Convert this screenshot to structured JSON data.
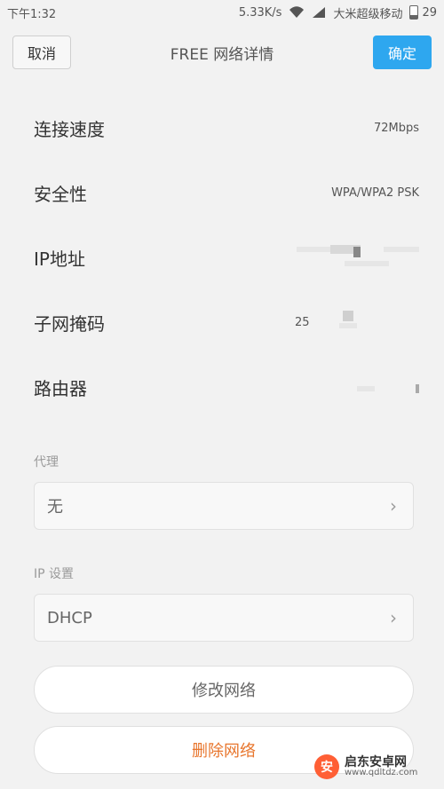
{
  "status_bar": {
    "time": "下午1:32",
    "speed": "5.33K/s",
    "carrier": "大米超级移动",
    "battery": "29",
    "battery_level_percent": 29
  },
  "header": {
    "cancel": "取消",
    "title": "FREE 网络详情",
    "confirm": "确定"
  },
  "info": [
    {
      "label": "连接速度",
      "value": "72Mbps"
    },
    {
      "label": "安全性",
      "value": "WPA/WPA2 PSK"
    },
    {
      "label": "IP地址",
      "value": ""
    },
    {
      "label": "子网掩码",
      "value": "25"
    },
    {
      "label": "路由器",
      "value": ""
    }
  ],
  "proxy": {
    "label": "代理",
    "value": "无"
  },
  "ip_settings": {
    "label": "IP 设置",
    "value": "DHCP"
  },
  "actions": {
    "modify": "修改网络",
    "delete": "删除网络"
  },
  "watermark": {
    "cn": "启东安卓网",
    "url": "www.qdltdz.com"
  },
  "colors": {
    "accent": "#2ea7ef",
    "delete_text": "#e8762d",
    "background": "#f2f2f2"
  }
}
